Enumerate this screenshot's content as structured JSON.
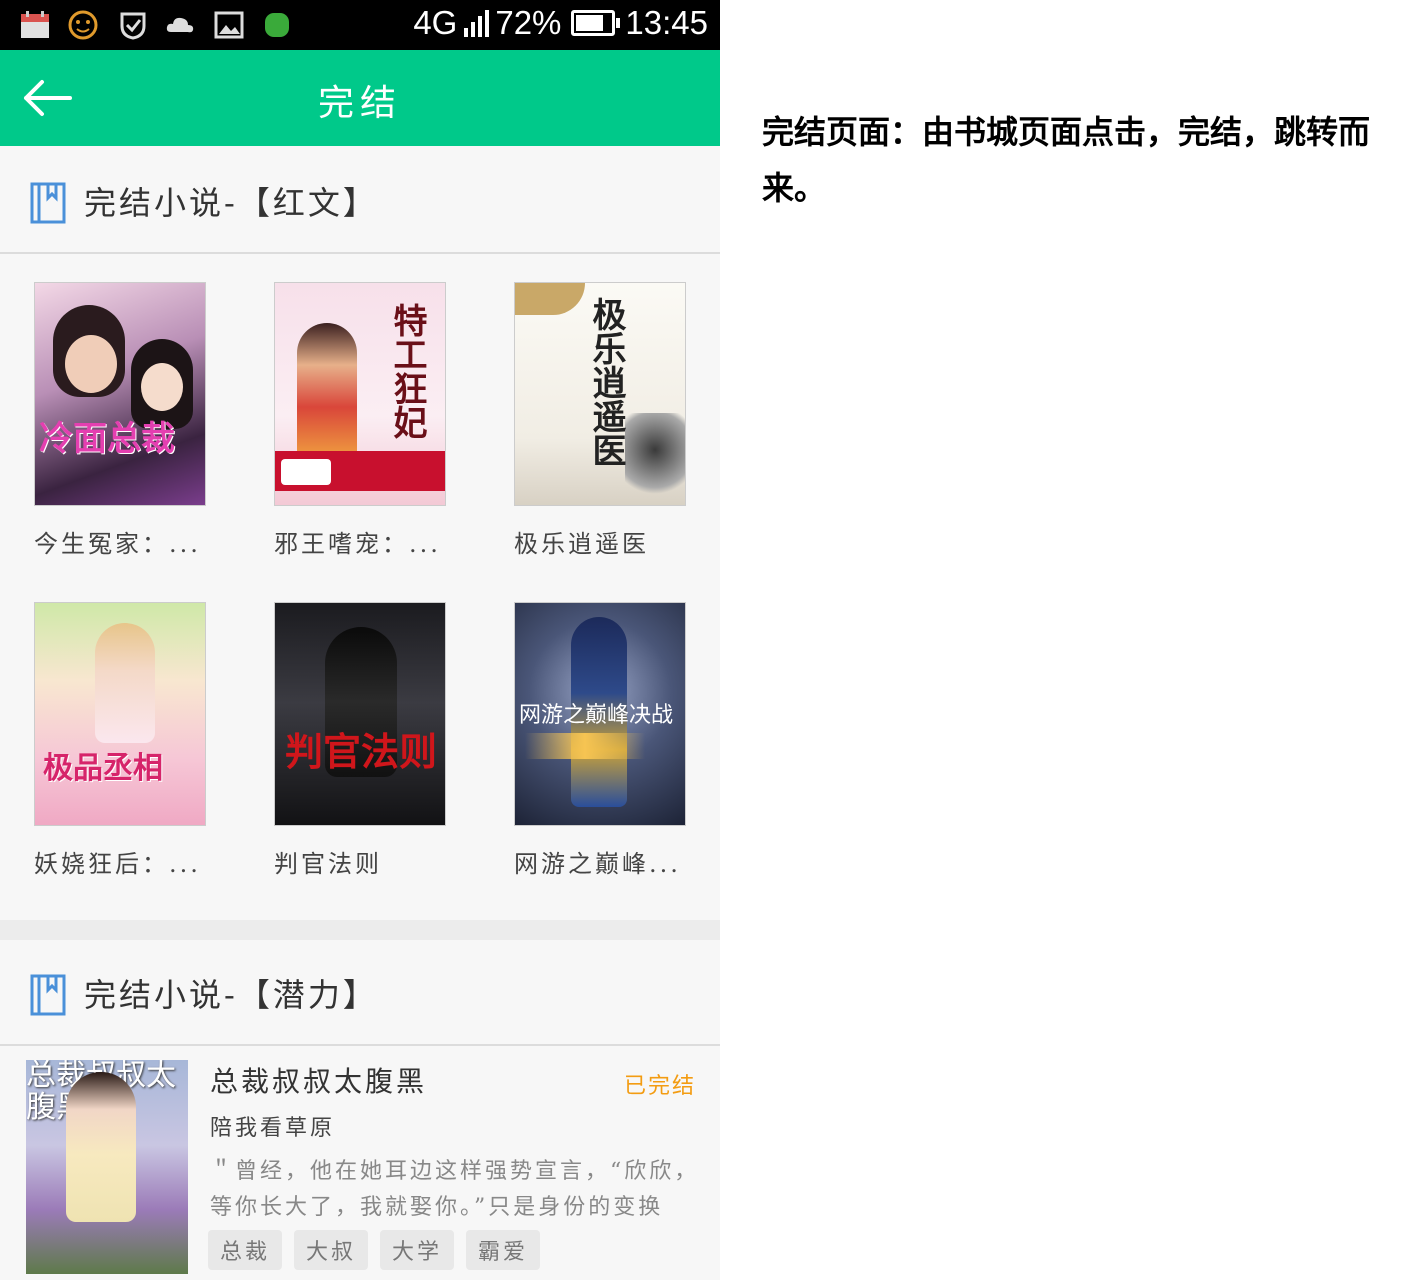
{
  "status_bar": {
    "network": "4G",
    "battery": "72%",
    "time": "13:45"
  },
  "header": {
    "title": "完结"
  },
  "section1": {
    "title": "完结小说-【红文】",
    "books": [
      {
        "title": "今生冤家：...",
        "cover_text": "冷面总裁"
      },
      {
        "title": "邪王嗜宠：...",
        "cover_text": "特工狂妃"
      },
      {
        "title": "极乐逍遥医",
        "cover_text": "极乐逍遥医"
      },
      {
        "title": "妖娆狂后：...",
        "cover_text": "极品丞相"
      },
      {
        "title": "判官法则",
        "cover_text": "判官法则"
      },
      {
        "title": "网游之巅峰...",
        "cover_text": "网游之巅峰决战"
      }
    ]
  },
  "section2": {
    "title": "完结小说-【潜力】",
    "item": {
      "title": "总裁叔叔太腹黑",
      "status": "已完结",
      "author": "陪我看草原",
      "description": "＂曾经，他在她耳边这样强势宣言，“欣欣，等你长大了，我就娶你。”只是身份的变换让...",
      "cover_text": "总裁叔叔太腹黑",
      "tags": [
        "总裁",
        "大叔",
        "大学",
        "霸爱"
      ]
    }
  },
  "caption": "完结页面：由书城页面点击，完结，跳转而来。",
  "colors": {
    "accent": "#00c98a",
    "status_orange": "#f39c12"
  }
}
